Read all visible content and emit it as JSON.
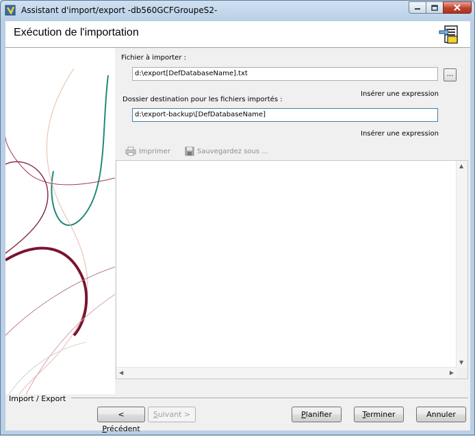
{
  "window": {
    "title": "Assistant d'import/export -db560GCFGroupeS2-"
  },
  "header": {
    "title": "Exécution de l'importation",
    "icon": "import-wizard-icon"
  },
  "form": {
    "file_label": "Fichier à importer :",
    "file_value": "d:\\export[DefDatabaseName].txt",
    "browse_label": "...",
    "insert_expression_1": "Insérer une expression",
    "folder_label": "Dossier destination pour les fichiers importés :",
    "folder_value": "d:\\export-backup\\[DefDatabaseName]",
    "insert_expression_2": "Insérer une expression"
  },
  "toolbar": {
    "print_label": "Imprimer",
    "save_as_label": "Sauvegardez sous ..."
  },
  "footer": {
    "group_label": "Import / Export",
    "prev_label": "< Précédent",
    "prev_mnemonic": "P",
    "prev_rest": "récédent",
    "next_label": "Suivant >",
    "next_mnemonic": "S",
    "next_rest": "uivant >",
    "plan_label": "Planifier",
    "plan_mnemonic": "P",
    "plan_rest": "lanifier",
    "finish_label": "Terminer",
    "finish_mnemonic": "T",
    "finish_rest": "erminer",
    "cancel_label": "Annuler"
  },
  "colors": {
    "accent_red": "#7a1531",
    "accent_teal": "#1e8a76",
    "window_frame": "#b9cfe6",
    "close_button": "#c2402c"
  }
}
